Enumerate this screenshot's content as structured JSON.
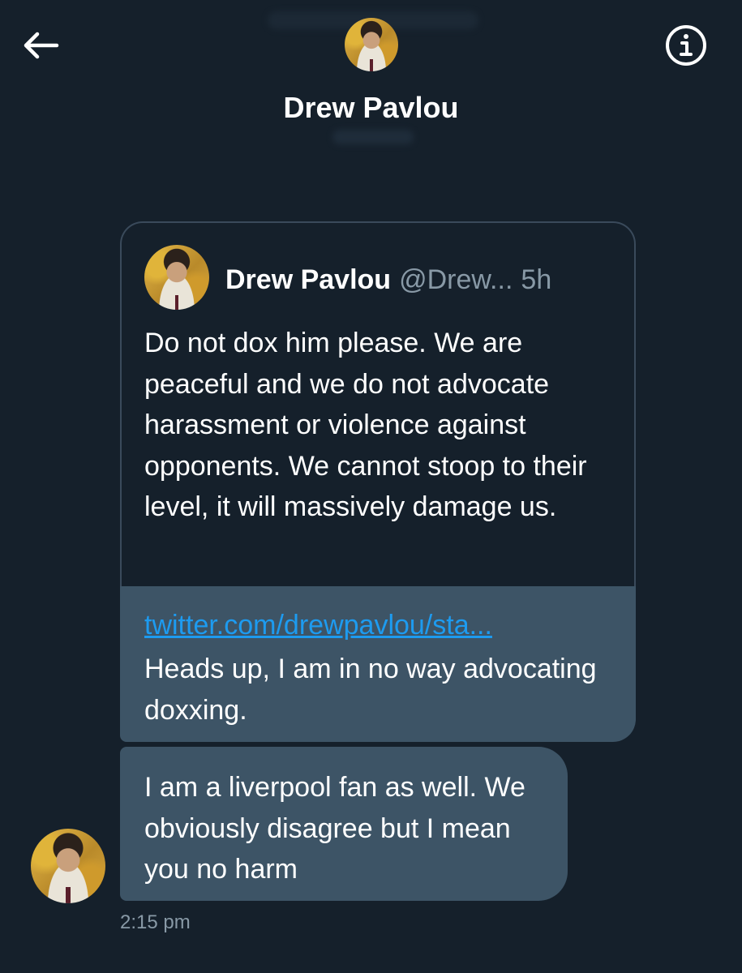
{
  "header": {
    "name": "Drew Pavlou"
  },
  "quoted_tweet": {
    "name": "Drew Pavlou",
    "handle": "@Drew...",
    "time": "5h",
    "text": "Do not dox him please. We are peaceful and we do not advocate harassment or violence against opponents. We cannot stoop to their level, it will massively damage us."
  },
  "messages": [
    {
      "link": "twitter.com/drewpavlou/sta...",
      "text": "Heads up, I am in no way advocating doxxing."
    },
    {
      "text": "I am a liverpool fan as well. We  obviously disagree but I mean you no harm"
    }
  ],
  "timestamp": "2:15 pm",
  "icons": {
    "back": "back-arrow-icon",
    "info": "info-icon"
  },
  "colors": {
    "background": "#15202b",
    "bubble": "#3d5466",
    "link": "#1d9bf0",
    "muted": "#8899a6"
  }
}
